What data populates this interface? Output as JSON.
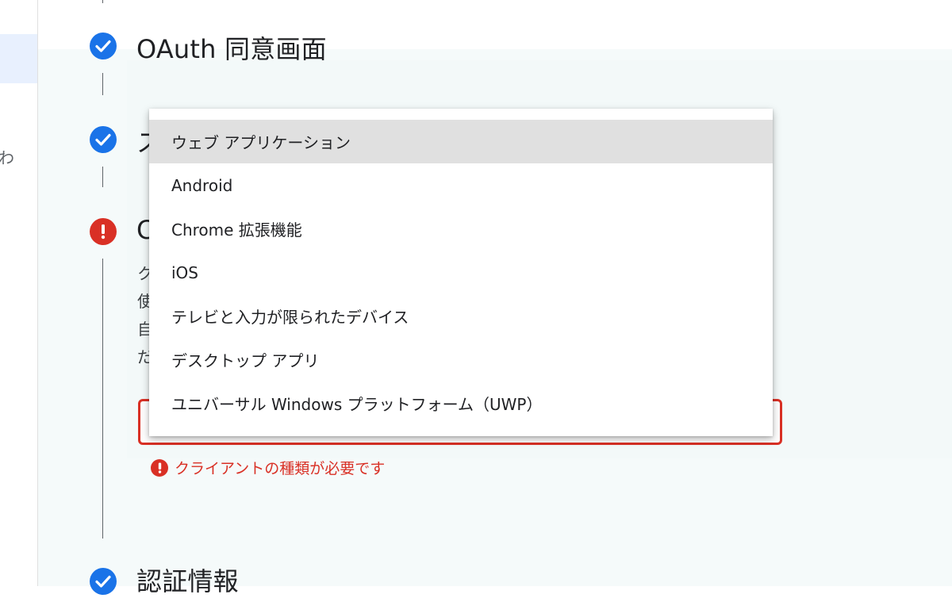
{
  "rail": {
    "clipped_label": "わ"
  },
  "steps": [
    {
      "title": "OAuth 同意画面",
      "status": "complete"
    },
    {
      "title": "ス",
      "status": "complete"
    },
    {
      "title": "C",
      "status": "error",
      "clipped_lines": [
        "ク",
        "使",
        "自",
        "だ"
      ]
    },
    {
      "title": "認証情報",
      "status": "complete"
    }
  ],
  "client_type_select": {
    "error_text": "クライアントの種類が必要です",
    "options": [
      "ウェブ アプリケーション",
      "Android",
      "Chrome 拡張機能",
      "iOS",
      "テレビと入力が限られたデバイス",
      "デスクトップ アプリ",
      "ユニバーサル Windows プラットフォーム（UWP）"
    ],
    "highlighted_index": 0
  },
  "colors": {
    "complete": "#1a73e8",
    "error": "#d93025",
    "highlight": "#e0e0e0"
  },
  "icons": {
    "complete": "check-circle-icon",
    "error": "error-circle-icon"
  }
}
